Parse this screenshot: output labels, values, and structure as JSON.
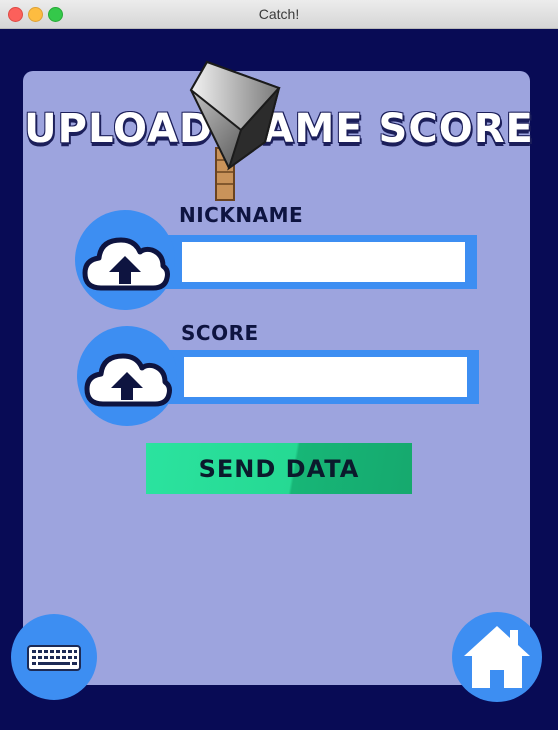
{
  "window": {
    "title": "Catch!"
  },
  "form": {
    "heading": "UPLOAD NAME SCORE",
    "nickname": {
      "label": "NICKNAME",
      "value": "",
      "placeholder": ""
    },
    "score": {
      "label": "SCORE",
      "value": "",
      "placeholder": ""
    },
    "send_label": "SEND DATA"
  },
  "icons": {
    "nickname_upload": "cloud-upload-icon",
    "score_upload": "cloud-upload-icon",
    "keyboard": "keyboard-icon",
    "home": "home-icon",
    "cursor": "hammer-cursor-icon"
  },
  "colors": {
    "background": "#080b55",
    "panel": "#9da4de",
    "accent_blue": "#3d8ef2",
    "send_green": "#2be39f",
    "text_dark": "#0e1440"
  }
}
